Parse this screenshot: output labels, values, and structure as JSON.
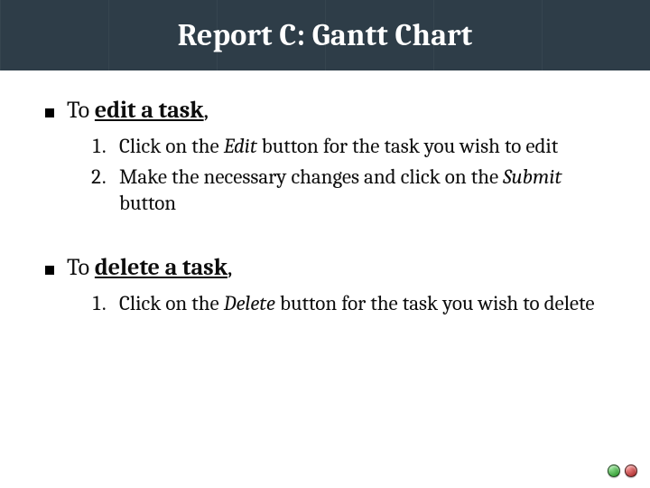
{
  "header": {
    "title": "Report C: Gantt Chart"
  },
  "sections": {
    "edit": {
      "lead_prefix": "To ",
      "action": "edit a task",
      "lead_suffix": ",",
      "steps": {
        "s1": {
          "pre": "Click on the ",
          "kw": "Edit",
          "post": " button for the task you wish to edit"
        },
        "s2": {
          "pre": "Make the necessary changes and click on the ",
          "kw": "Submit",
          "post": " button"
        }
      }
    },
    "delete": {
      "lead_prefix": "To ",
      "action": "delete a task",
      "lead_suffix": ",",
      "steps": {
        "s1": {
          "pre": "Click on the ",
          "kw": "Delete",
          "post": " button for the task you wish to delete"
        }
      }
    }
  },
  "nav": {
    "prev": "prev-slide",
    "next": "next-slide"
  }
}
